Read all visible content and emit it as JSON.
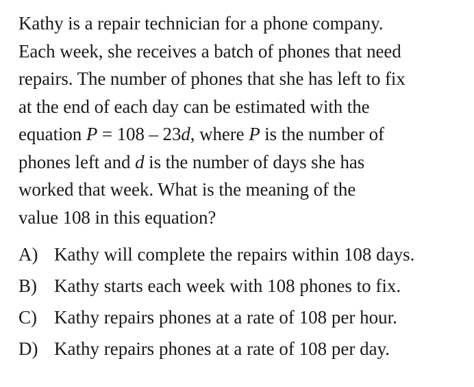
{
  "question": {
    "line1": "Kathy is a repair technician for a phone company.",
    "line2": "Each week, she receives a batch of phones that need",
    "line3": "repairs.  The number of phones that she has left to fix",
    "line4": "at the end of each day can be estimated with the",
    "line5_pre": "equation ",
    "line5_var_p": "P",
    "line5_eq": " = 108 – 23",
    "line5_var_d": "d",
    "line5_post": ", where ",
    "line5_var_p2": "P",
    "line5_end": " is the number of",
    "line6_pre": "phones left and ",
    "line6_var_d": "d",
    "line6_end": " is the number of days she has",
    "line7": "worked that week.  What is the meaning of the",
    "line8": "value 108 in this equation?"
  },
  "choices": [
    {
      "letter": "A)",
      "text": "Kathy will complete the repairs within 108 days."
    },
    {
      "letter": "B)",
      "text": "Kathy starts each week with 108 phones to fix."
    },
    {
      "letter": "C)",
      "text": "Kathy repairs phones at a rate of 108 per hour."
    },
    {
      "letter": "D)",
      "text": "Kathy repairs phones at a rate of 108 per day."
    }
  ]
}
